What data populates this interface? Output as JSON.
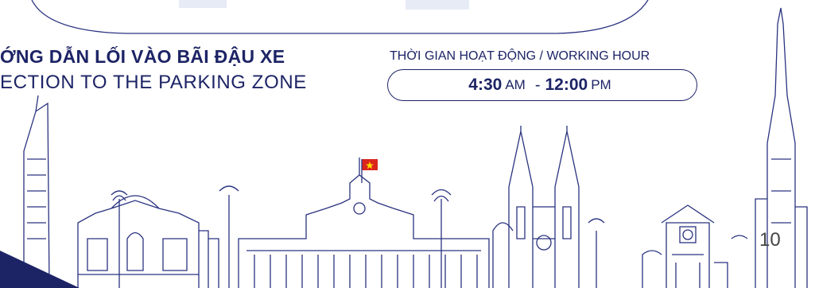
{
  "header": {
    "title_vi": "ỚNG DẪN LỐI VÀO BÃI ĐẬU XE",
    "title_en": "ECTION TO THE PARKING ZONE"
  },
  "working_hours": {
    "label": "THỜI GIAN HOẠT ĐỘNG / WORKING HOUR",
    "open_time": "4:30",
    "open_suffix": "AM",
    "separator": "-",
    "close_time": "12:00",
    "close_suffix": "PM"
  },
  "page_number": "10",
  "colors": {
    "primary": "#1d2466",
    "line_art": "#2a3380",
    "flag_red": "#da251d",
    "flag_star": "#ffde00",
    "banner_tint": "#b7c6e6"
  },
  "icons": [
    "skyline-illustration",
    "vietnam-flag-icon",
    "corner-triangle"
  ]
}
